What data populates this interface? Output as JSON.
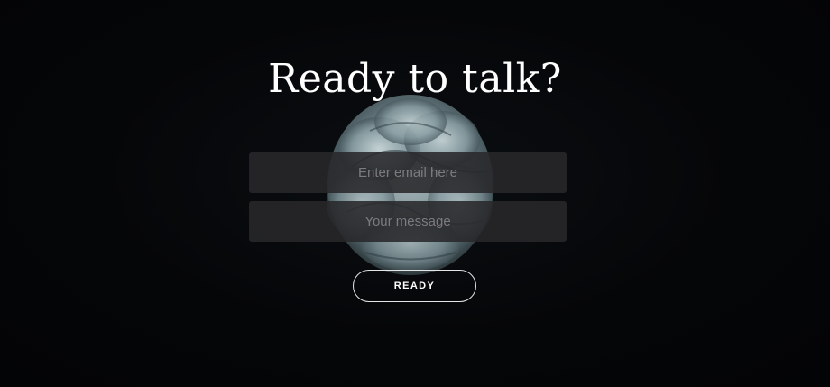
{
  "hero": {
    "title": "Ready to talk?"
  },
  "form": {
    "email_placeholder": "Enter email here",
    "message_placeholder": "Your message",
    "submit_label": "READY"
  },
  "colors": {
    "background": "#040507",
    "field_background": "#28282a",
    "flower": "#8aa0a6"
  }
}
